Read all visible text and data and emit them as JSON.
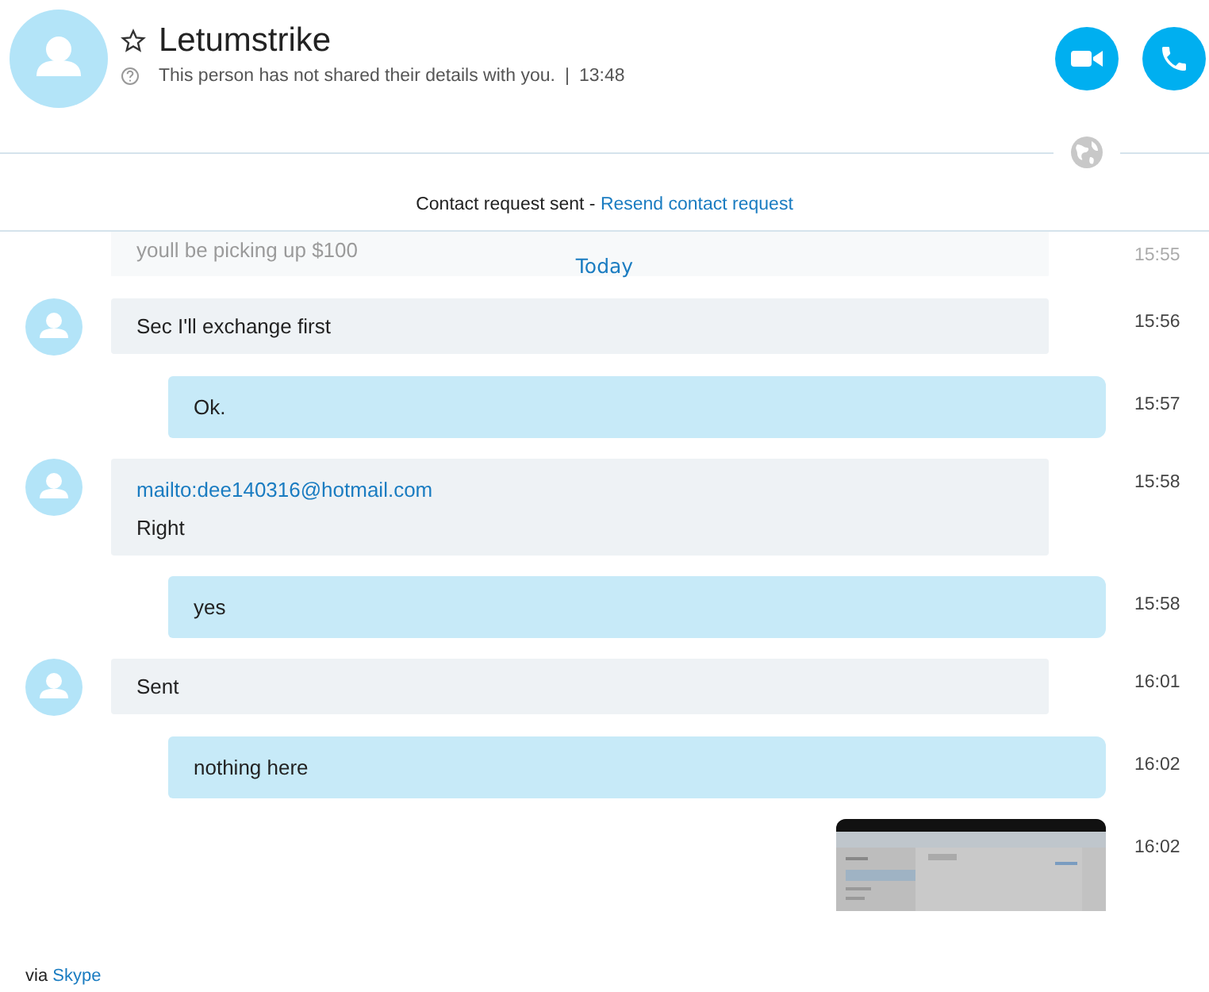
{
  "contact": {
    "name": "Letumstrike",
    "favorite": false,
    "status": "This person has not shared their details with you.",
    "separator": "|",
    "time": "13:48"
  },
  "notice": {
    "text": "Contact request sent - ",
    "link": "Resend contact request"
  },
  "day_label": "Today",
  "messages": [
    {
      "kind": "incoming",
      "faded": true,
      "lines": [
        "youll be picking up $100"
      ],
      "time": "15:55"
    },
    {
      "kind": "incoming",
      "faded": false,
      "lines": [
        "Sec I'll exchange first"
      ],
      "time": "15:56"
    },
    {
      "kind": "outgoing",
      "faded": false,
      "lines": [
        "Ok."
      ],
      "time": "15:57"
    },
    {
      "kind": "incoming",
      "faded": false,
      "link": "mailto:dee140316@hotmail.com",
      "lines": [
        "Right"
      ],
      "time": "15:58"
    },
    {
      "kind": "outgoing",
      "faded": false,
      "lines": [
        "yes"
      ],
      "time": "15:58"
    },
    {
      "kind": "incoming",
      "faded": false,
      "lines": [
        "Sent"
      ],
      "time": "16:01"
    },
    {
      "kind": "outgoing",
      "faded": false,
      "lines": [
        "nothing here"
      ],
      "time": "16:02"
    },
    {
      "faded": false,
      "time": "16:02"
    }
  ],
  "footer": {
    "prefix": "via ",
    "link": "Skype"
  }
}
